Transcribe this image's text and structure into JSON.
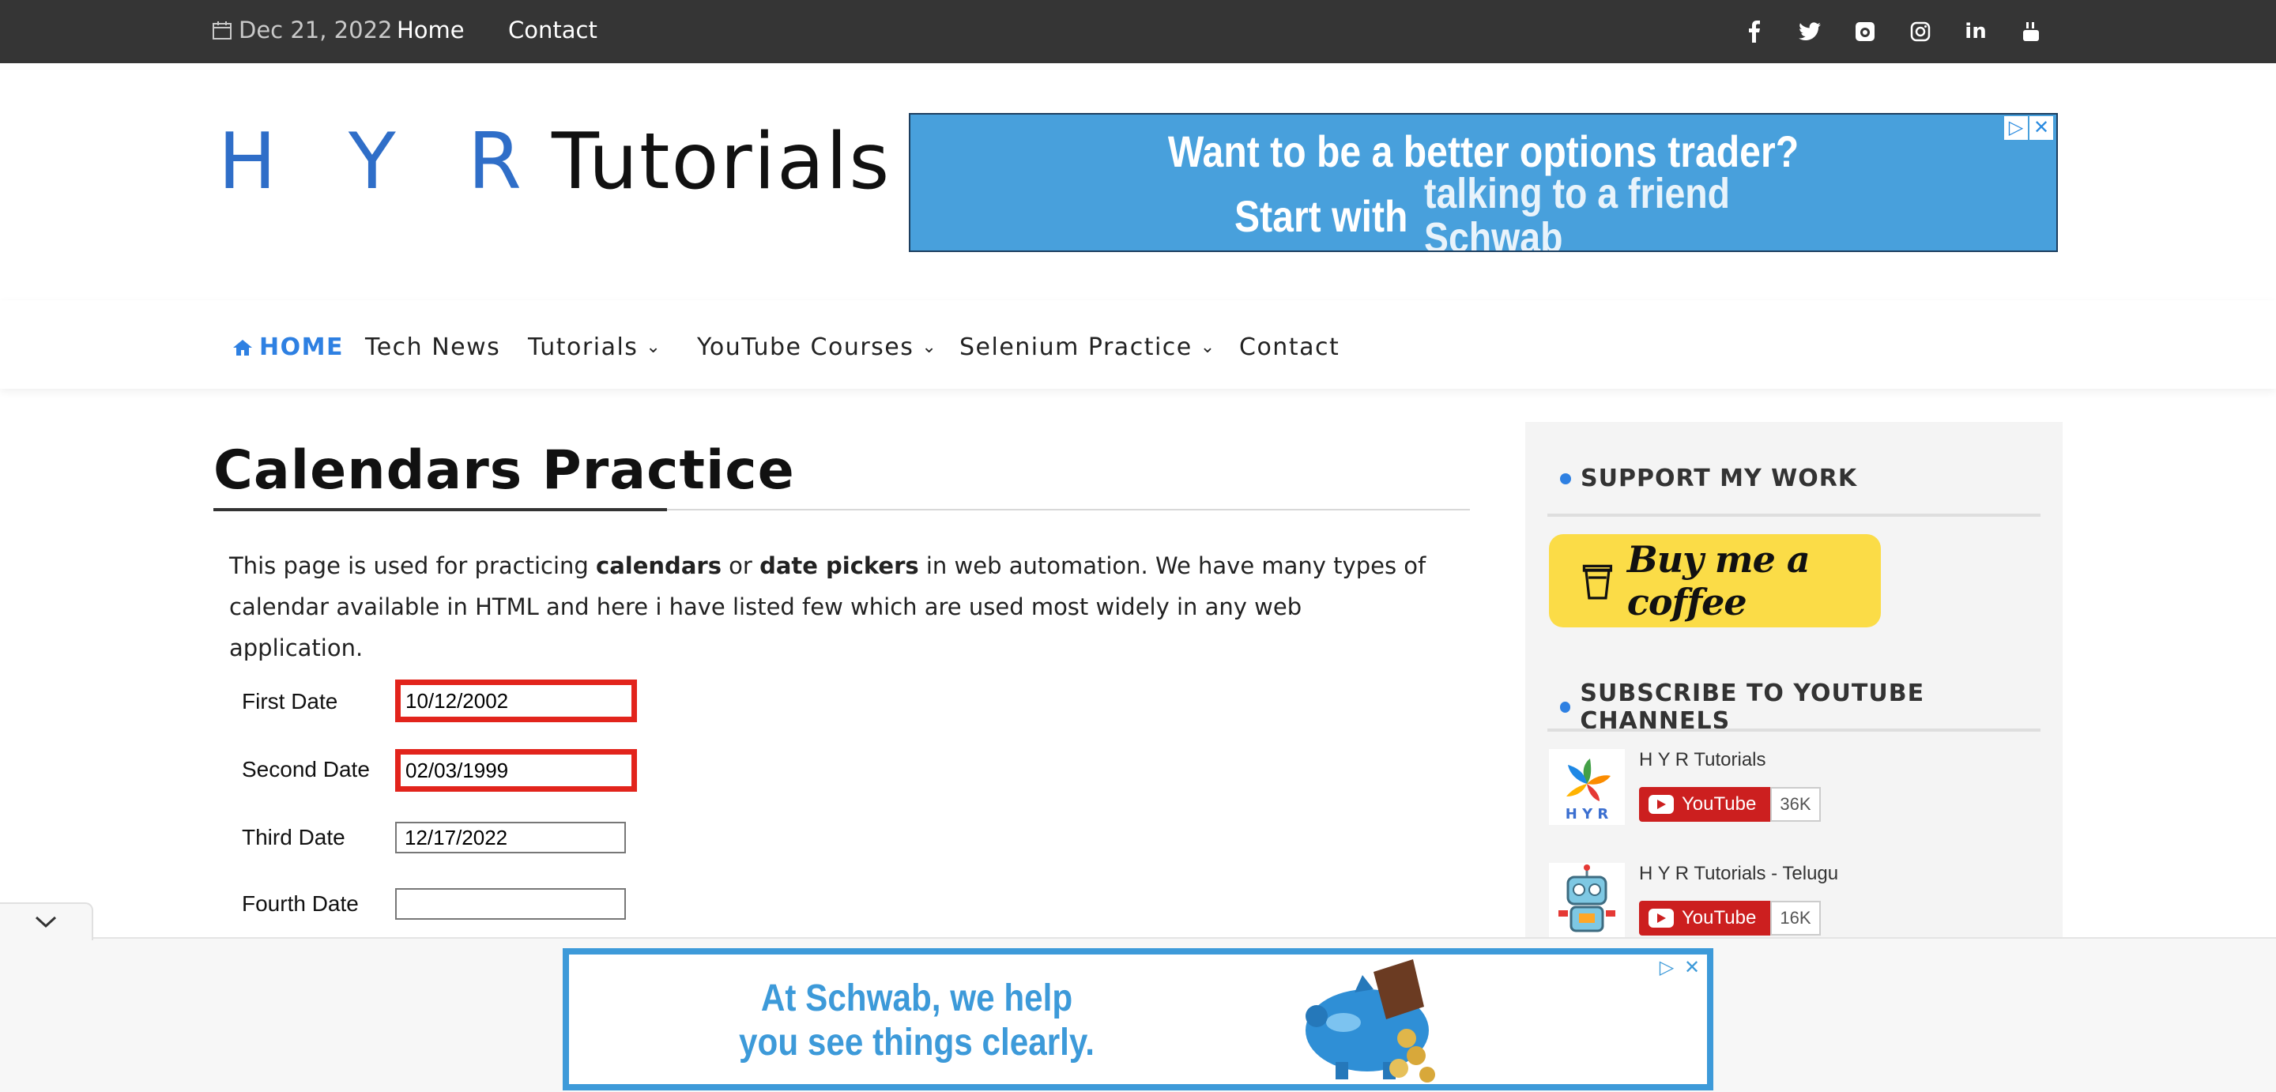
{
  "topbar": {
    "date": "Dec 21, 2022",
    "links": [
      "Home",
      "Contact"
    ],
    "social_icons": [
      "facebook-icon",
      "twitter-icon",
      "github-icon",
      "instagram-icon",
      "linkedin-icon",
      "youtube-icon"
    ]
  },
  "header": {
    "logo_hyr": "H Y R",
    "logo_tutorials": "Tutorials",
    "ad": {
      "line1": "Want to be a better options trader?",
      "line2": "Start with",
      "line3a": "talking to a friend",
      "line3b": "Schwab"
    }
  },
  "nav": {
    "home": "HOME",
    "items": [
      "Tech News",
      "Tutorials",
      "YouTube Courses",
      "Selenium Practice",
      "Contact"
    ]
  },
  "main": {
    "title": "Calendars Practice",
    "intro_a": "This page is used for practicing ",
    "intro_b1": "calendars",
    "intro_c": " or ",
    "intro_b2": "date pickers",
    "intro_d": " in web automation. We have many types of calendar available in HTML and here i have listed few which are used most widely in any web application.",
    "fields": [
      {
        "label": "First Date",
        "value": "10/12/2002"
      },
      {
        "label": "Second Date",
        "value": "02/03/1999"
      },
      {
        "label": "Third Date",
        "value": "12/17/2022"
      },
      {
        "label": "Fourth Date",
        "value": ""
      }
    ]
  },
  "sidebar": {
    "support_heading": "SUPPORT MY WORK",
    "bmc_label": "Buy me a coffee",
    "subscribe_heading": "SUBSCRIBE TO YOUTUBE CHANNELS",
    "channels": [
      {
        "name": "H Y R Tutorials",
        "button": "YouTube",
        "count": "36K"
      },
      {
        "name": "H Y R Tutorials - Telugu",
        "button": "YouTube",
        "count": "16K"
      }
    ]
  },
  "bottom_ad": {
    "line1": "At Schwab, we help",
    "line2": "you see things clearly."
  },
  "colors": {
    "accent": "#2e80e2",
    "topbar_bg": "#353535",
    "highlight_border": "#e2241c",
    "bmc_yellow": "#fbdc47",
    "ad_blue": "#48a0dc"
  }
}
